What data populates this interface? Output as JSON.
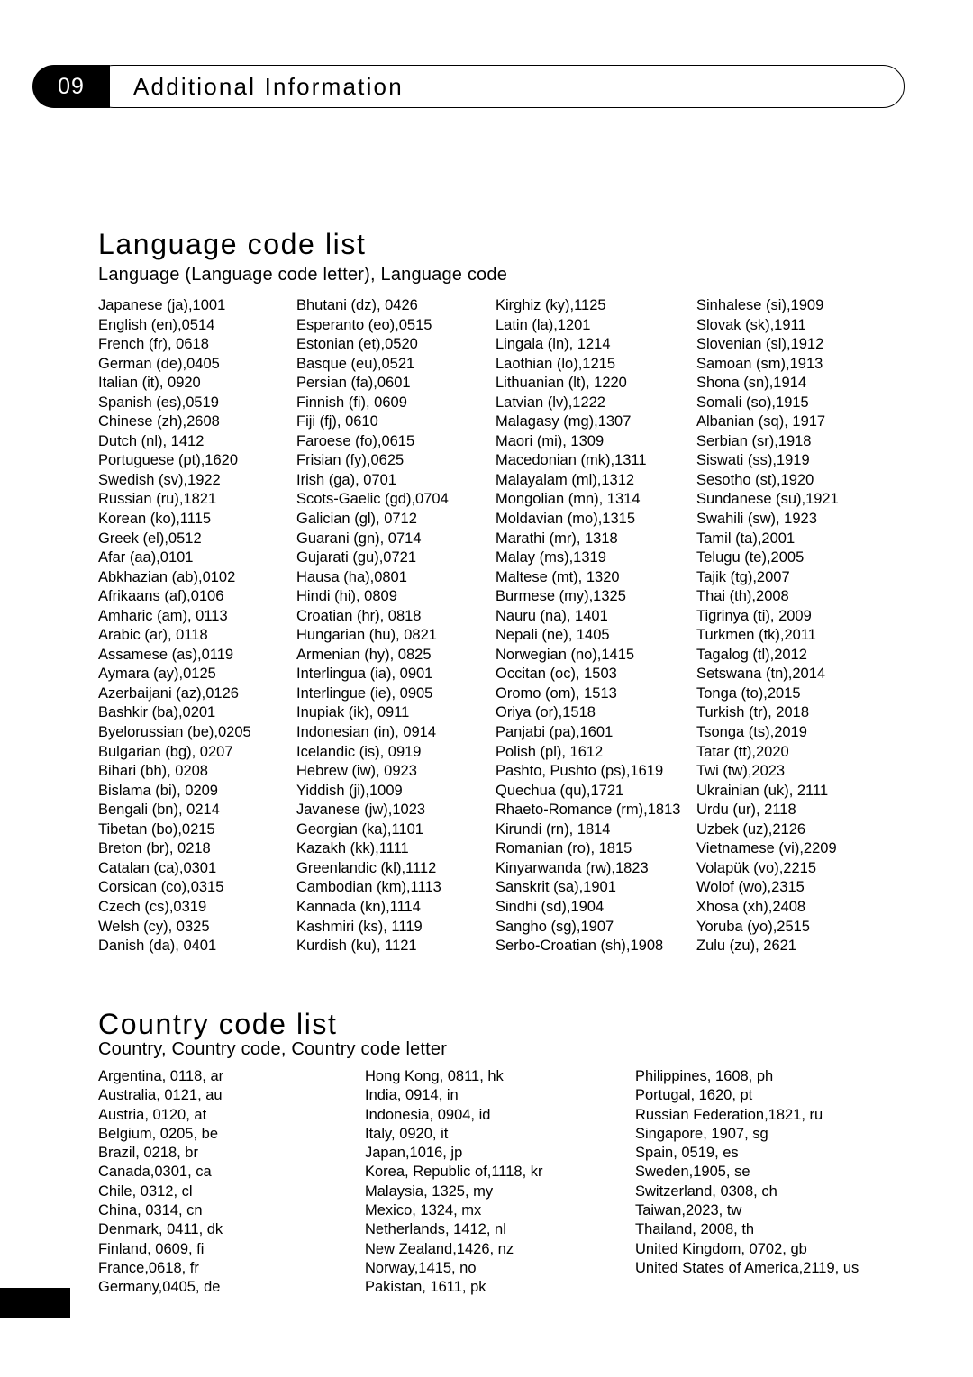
{
  "header": {
    "chapter_number": "09",
    "title": "Additional Information"
  },
  "language_section": {
    "title": "Language code list",
    "subtitle": "Language (Language code letter), Language code",
    "columns": [
      [
        "Japanese (ja),1001",
        "English (en),0514",
        "French (fr), 0618",
        "German (de),0405",
        "Italian (it), 0920",
        "Spanish (es),0519",
        "Chinese (zh),2608",
        "Dutch (nl), 1412",
        "Portuguese (pt),1620",
        "Swedish (sv),1922",
        "Russian (ru),1821",
        "Korean (ko),1115",
        "Greek (el),0512",
        "Afar (aa),0101",
        "Abkhazian (ab),0102",
        "Afrikaans (af),0106",
        "Amharic (am), 0113",
        "Arabic (ar), 0118",
        "Assamese (as),0119",
        "Aymara (ay),0125",
        "Azerbaijani (az),0126",
        "Bashkir (ba),0201",
        "Byelorussian (be),0205",
        "Bulgarian (bg), 0207",
        "Bihari (bh), 0208",
        "Bislama (bi), 0209",
        "Bengali (bn), 0214",
        "Tibetan (bo),0215",
        "Breton (br), 0218",
        "Catalan (ca),0301",
        "Corsican (co),0315",
        "Czech (cs),0319",
        "Welsh (cy), 0325",
        "Danish (da), 0401"
      ],
      [
        "Bhutani (dz), 0426",
        "Esperanto (eo),0515",
        "Estonian (et),0520",
        "Basque (eu),0521",
        "Persian (fa),0601",
        "Finnish (fi), 0609",
        "Fiji (fj), 0610",
        "Faroese (fo),0615",
        "Frisian (fy),0625",
        "Irish (ga), 0701",
        "Scots-Gaelic (gd),0704",
        "Galician (gl), 0712",
        "Guarani (gn), 0714",
        "Gujarati (gu),0721",
        "Hausa (ha),0801",
        "Hindi (hi), 0809",
        "Croatian (hr), 0818",
        "Hungarian (hu), 0821",
        "Armenian (hy), 0825",
        "Interlingua (ia), 0901",
        "Interlingue (ie), 0905",
        "Inupiak (ik), 0911",
        "Indonesian (in), 0914",
        "Icelandic (is), 0919",
        "Hebrew (iw), 0923",
        "Yiddish (ji),1009",
        "Javanese (jw),1023",
        "Georgian (ka),1101",
        "Kazakh (kk),1111",
        "Greenlandic  (kl),1112",
        "Cambodian (km),1113",
        "Kannada (kn),1114",
        "Kashmiri (ks), 1119",
        "Kurdish (ku), 1121"
      ],
      [
        "Kirghiz (ky),1125",
        "Latin (la),1201",
        "Lingala (ln), 1214",
        "Laothian (lo),1215",
        "Lithuanian (lt), 1220",
        "Latvian (lv),1222",
        "Malagasy (mg),1307",
        "Maori (mi), 1309",
        "Macedonian (mk),1311",
        "Malayalam  (ml),1312",
        "Mongolian (mn), 1314",
        "Moldavian (mo),1315",
        "Marathi (mr), 1318",
        "Malay  (ms),1319",
        "Maltese (mt), 1320",
        "Burmese (my),1325",
        "Nauru (na), 1401",
        "Nepali (ne), 1405",
        "Norwegian (no),1415",
        "Occitan (oc), 1503",
        "Oromo (om), 1513",
        "Oriya (or),1518",
        "Panjabi (pa),1601",
        "Polish (pl), 1612",
        "Pashto, Pushto (ps),1619",
        "Quechua (qu),1721",
        "Rhaeto-Romance (rm),1813",
        "Kirundi (rn), 1814",
        "Romanian (ro), 1815",
        "Kinyarwanda (rw),1823",
        "Sanskrit (sa),1901",
        "Sindhi (sd),1904",
        "Sangho (sg),1907",
        "Serbo-Croatian (sh),1908"
      ],
      [
        "Sinhalese (si),1909",
        "Slovak (sk),1911",
        "Slovenian (sl),1912",
        "Samoan (sm),1913",
        "Shona (sn),1914",
        "Somali (so),1915",
        "Albanian (sq), 1917",
        "Serbian (sr),1918",
        "Siswati (ss),1919",
        "Sesotho (st),1920",
        "Sundanese (su),1921",
        "Swahili (sw), 1923",
        "Tamil (ta),2001",
        "Telugu (te),2005",
        "Tajik (tg),2007",
        "Thai (th),2008",
        "Tigrinya (ti), 2009",
        "Turkmen (tk),2011",
        "Tagalog (tl),2012",
        "Setswana (tn),2014",
        "Tonga (to),2015",
        "Turkish (tr), 2018",
        "Tsonga (ts),2019",
        "Tatar (tt),2020",
        "Twi (tw),2023",
        "Ukrainian (uk), 2111",
        "Urdu (ur), 2118",
        "Uzbek (uz),2126",
        "Vietnamese (vi),2209",
        "Volapük (vo),2215",
        "Wolof (wo),2315",
        "Xhosa (xh),2408",
        "Yoruba (yo),2515",
        "Zulu (zu), 2621"
      ]
    ]
  },
  "country_section": {
    "title": "Country code list",
    "subtitle": "Country, Country code, Country code letter",
    "columns": [
      [
        "Argentina, 0118, ar",
        "Australia, 0121, au",
        "Austria, 0120, at",
        "Belgium, 0205, be",
        "Brazil, 0218, br",
        "Canada,0301, ca",
        "Chile, 0312, cl",
        "China, 0314, cn",
        "Denmark, 0411, dk",
        "Finland, 0609, fi",
        "France,0618, fr",
        "Germany,0405, de"
      ],
      [
        "Hong Kong, 0811, hk",
        "India, 0914, in",
        "Indonesia, 0904, id",
        "Italy, 0920, it",
        "Japan,1016, jp",
        "Korea, Republic of,1118, kr",
        "Malaysia, 1325, my",
        "Mexico, 1324, mx",
        "Netherlands, 1412, nl",
        "New Zealand,1426, nz",
        "Norway,1415, no",
        "Pakistan, 1611, pk"
      ],
      [
        "Philippines, 1608, ph",
        "Portugal, 1620, pt",
        "Russian Federation,1821, ru",
        "Singapore, 1907, sg",
        "Spain, 0519, es",
        "Sweden,1905, se",
        "Switzerland, 0308, ch",
        "Taiwan,2023, tw",
        "Thailand, 2008, th",
        "United Kingdom, 0702, gb",
        "United States of America,2119, us"
      ]
    ]
  }
}
